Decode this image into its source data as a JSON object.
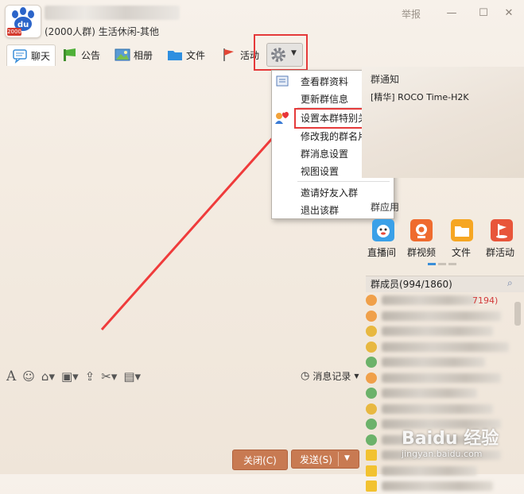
{
  "header": {
    "group_meta": "(2000人群) 生活休闲-其他",
    "report": "举报",
    "logo_badge": "2000"
  },
  "tabs": [
    {
      "label": "聊天",
      "icon": "chat-icon"
    },
    {
      "label": "公告",
      "icon": "megaphone-icon"
    },
    {
      "label": "相册",
      "icon": "photo-album-icon"
    },
    {
      "label": "文件",
      "icon": "folder-icon"
    },
    {
      "label": "活动",
      "icon": "flag-icon"
    }
  ],
  "menu": {
    "items": [
      {
        "label": "查看群资料"
      },
      {
        "label": "更新群信息"
      },
      {
        "label": "设置本群特别关注"
      },
      {
        "label": "修改我的群名片"
      },
      {
        "label": "群消息设置"
      },
      {
        "label": "视图设置"
      },
      {
        "label": "邀请好友入群"
      },
      {
        "label": "退出该群"
      }
    ]
  },
  "right_panel": {
    "notice_title": "群通知",
    "notice_item": "[精华] ROCO Time-H2K",
    "apps_title": "群应用",
    "apps": [
      {
        "label": "直播间",
        "color": "#3aa0e8"
      },
      {
        "label": "群视频",
        "color": "#ef6b2e"
      },
      {
        "label": "文件",
        "color": "#f6a623"
      },
      {
        "label": "群活动",
        "color": "#e8553a"
      }
    ],
    "members_title": "群成员(994/1860)",
    "member_count_fragment": "7194)"
  },
  "bottom": {
    "history": "消息记录",
    "close": "关闭(C)",
    "send": "发送(S)"
  },
  "watermark": {
    "main": "Baidu 经验",
    "sub": "jingyan.baidu.com"
  },
  "colors": {
    "highlight_red": "#e53a3a",
    "button_orange": "#c87a52"
  }
}
